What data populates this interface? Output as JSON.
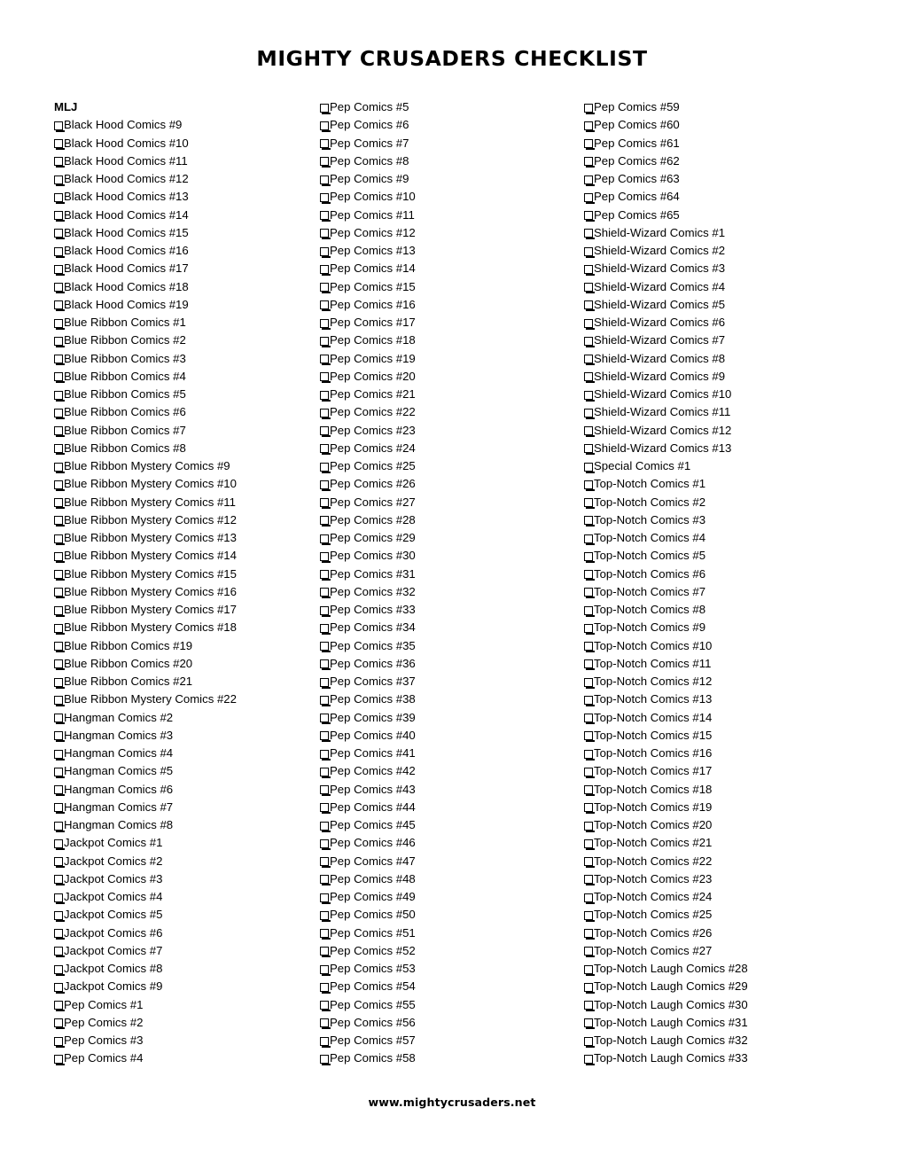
{
  "document": {
    "title": "MIGHTY CRUSADERS CHECKLIST",
    "footer": "www.mightycrusaders.net"
  },
  "checkbox_glyph": "empty-square",
  "columns": [
    {
      "id": "column-1",
      "header": "MLJ",
      "items": [
        "Black Hood Comics #9",
        "Black Hood Comics #10",
        "Black Hood Comics #11",
        "Black Hood Comics #12",
        "Black Hood Comics #13",
        "Black Hood Comics #14",
        "Black Hood Comics #15",
        "Black Hood Comics #16",
        "Black Hood Comics #17",
        "Black Hood Comics #18",
        "Black Hood Comics #19",
        "Blue Ribbon Comics #1",
        "Blue Ribbon Comics #2",
        "Blue Ribbon Comics #3",
        "Blue Ribbon Comics #4",
        "Blue Ribbon Comics #5",
        "Blue Ribbon Comics #6",
        "Blue Ribbon Comics #7",
        "Blue Ribbon Comics #8",
        "Blue Ribbon Mystery Comics #9",
        "Blue Ribbon Mystery Comics #10",
        "Blue Ribbon Mystery Comics #11",
        "Blue Ribbon Mystery Comics #12",
        "Blue Ribbon Mystery Comics #13",
        "Blue Ribbon Mystery Comics #14",
        "Blue Ribbon Mystery Comics #15",
        "Blue Ribbon Mystery Comics #16",
        "Blue Ribbon Mystery Comics #17",
        "Blue Ribbon Mystery Comics #18",
        "Blue Ribbon Comics #19",
        "Blue Ribbon Comics #20",
        "Blue Ribbon Comics #21",
        "Blue Ribbon Mystery Comics #22",
        "Hangman Comics #2",
        "Hangman Comics #3",
        "Hangman Comics #4",
        "Hangman Comics #5",
        "Hangman Comics #6",
        "Hangman Comics #7",
        "Hangman Comics #8",
        "Jackpot Comics #1",
        "Jackpot Comics #2",
        "Jackpot Comics #3",
        "Jackpot Comics #4",
        "Jackpot Comics #5",
        "Jackpot Comics #6",
        "Jackpot Comics #7",
        "Jackpot Comics #8",
        "Jackpot Comics #9",
        "Pep Comics #1",
        "Pep Comics #2",
        "Pep Comics #3",
        "Pep Comics #4"
      ]
    },
    {
      "id": "column-2",
      "header": "",
      "items": [
        "Pep Comics #5",
        "Pep Comics #6",
        "Pep Comics #7",
        "Pep Comics #8",
        "Pep Comics #9",
        "Pep Comics #10",
        "Pep Comics #11",
        "Pep Comics #12",
        "Pep Comics #13",
        "Pep Comics #14",
        "Pep Comics #15",
        "Pep Comics #16",
        "Pep Comics #17",
        "Pep Comics #18",
        "Pep Comics #19",
        "Pep Comics #20",
        "Pep Comics #21",
        "Pep Comics #22",
        "Pep Comics #23",
        "Pep Comics #24",
        "Pep Comics #25",
        "Pep Comics #26",
        "Pep Comics #27",
        "Pep Comics #28",
        "Pep Comics #29",
        "Pep Comics #30",
        "Pep Comics #31",
        "Pep Comics #32",
        "Pep Comics #33",
        "Pep Comics #34",
        "Pep Comics #35",
        "Pep Comics #36",
        "Pep Comics #37",
        "Pep Comics #38",
        "Pep Comics #39",
        "Pep Comics #40",
        "Pep Comics #41",
        "Pep Comics #42",
        "Pep Comics #43",
        "Pep Comics #44",
        "Pep Comics #45",
        "Pep Comics #46",
        "Pep Comics #47",
        "Pep Comics #48",
        "Pep Comics #49",
        "Pep Comics #50",
        "Pep Comics #51",
        "Pep Comics #52",
        "Pep Comics #53",
        "Pep Comics #54",
        "Pep Comics #55",
        "Pep Comics #56",
        "Pep Comics #57",
        "Pep Comics #58"
      ]
    },
    {
      "id": "column-3",
      "header": "",
      "items": [
        "Pep Comics #59",
        "Pep Comics #60",
        "Pep Comics #61",
        "Pep Comics #62",
        "Pep Comics #63",
        "Pep Comics #64",
        "Pep Comics #65",
        "Shield-Wizard Comics #1",
        "Shield-Wizard Comics #2",
        "Shield-Wizard Comics #3",
        "Shield-Wizard Comics #4",
        "Shield-Wizard Comics #5",
        "Shield-Wizard Comics #6",
        "Shield-Wizard Comics #7",
        "Shield-Wizard Comics #8",
        "Shield-Wizard Comics #9",
        "Shield-Wizard Comics #10",
        "Shield-Wizard Comics #11",
        "Shield-Wizard Comics #12",
        "Shield-Wizard Comics #13",
        "Special Comics #1",
        "Top-Notch Comics #1",
        "Top-Notch Comics #2",
        "Top-Notch Comics #3",
        "Top-Notch Comics #4",
        "Top-Notch Comics #5",
        "Top-Notch Comics #6",
        "Top-Notch Comics #7",
        "Top-Notch Comics #8",
        "Top-Notch Comics #9",
        "Top-Notch Comics #10",
        "Top-Notch Comics #11",
        "Top-Notch Comics #12",
        "Top-Notch Comics #13",
        "Top-Notch Comics #14",
        "Top-Notch Comics #15",
        "Top-Notch Comics #16",
        "Top-Notch Comics #17",
        "Top-Notch Comics #18",
        "Top-Notch Comics #19",
        "Top-Notch Comics #20",
        "Top-Notch Comics #21",
        "Top-Notch Comics #22",
        "Top-Notch Comics #23",
        "Top-Notch Comics #24",
        "Top-Notch Comics #25",
        "Top-Notch Comics #26",
        "Top-Notch Comics #27",
        "Top-Notch Laugh Comics #28",
        "Top-Notch Laugh Comics #29",
        "Top-Notch Laugh Comics #30",
        "Top-Notch Laugh Comics #31",
        "Top-Notch Laugh Comics #32",
        "Top-Notch Laugh Comics #33"
      ]
    }
  ]
}
